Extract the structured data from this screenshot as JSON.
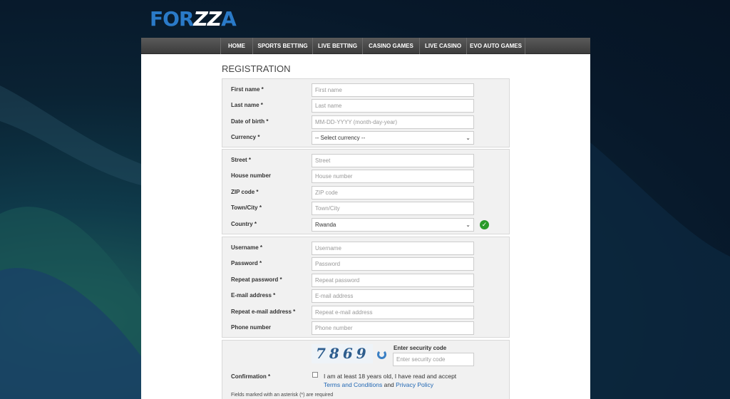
{
  "logo": {
    "part1": "FOR",
    "part2": "ZZ",
    "part3": "A"
  },
  "nav": {
    "items": [
      {
        "label": "HOME"
      },
      {
        "label": "SPORTS BETTING"
      },
      {
        "label": "LIVE BETTING"
      },
      {
        "label": "CASINO GAMES"
      },
      {
        "label": "LIVE CASINO"
      },
      {
        "label": "EVO AUTO GAMES"
      }
    ]
  },
  "form": {
    "title": "REGISTRATION",
    "first_name": {
      "label": "First name *",
      "placeholder": "First name"
    },
    "last_name": {
      "label": "Last name *",
      "placeholder": "Last name"
    },
    "dob": {
      "label": "Date of birth *",
      "placeholder": "MM-DD-YYYY (month-day-year)"
    },
    "currency": {
      "label": "Currency *",
      "value": "-- Select currency --"
    },
    "street": {
      "label": "Street *",
      "placeholder": "Street"
    },
    "house_number": {
      "label": "House number",
      "placeholder": "House number"
    },
    "zip": {
      "label": "ZIP code *",
      "placeholder": "ZIP code"
    },
    "town": {
      "label": "Town/City *",
      "placeholder": "Town/City"
    },
    "country": {
      "label": "Country *",
      "value": "Rwanda"
    },
    "username": {
      "label": "Username *",
      "placeholder": "Username"
    },
    "password": {
      "label": "Password *",
      "placeholder": "Password"
    },
    "repeat_password": {
      "label": "Repeat password *",
      "placeholder": "Repeat password"
    },
    "email": {
      "label": "E-mail address *",
      "placeholder": "E-mail address"
    },
    "repeat_email": {
      "label": "Repeat e-mail address *",
      "placeholder": "Repeat e-mail address"
    },
    "phone": {
      "label": "Phone number",
      "placeholder": "Phone number"
    },
    "confirmation": {
      "label": "Confirmation *",
      "captcha_text": "7869",
      "security_label": "Enter security code",
      "security_placeholder": "Enter security code",
      "text_before": "I am at least 18 years old, I have read and accept",
      "terms_link": "Terms and Conditions",
      "and": "and",
      "privacy_link": "Privacy Policy",
      "note": "Fields marked with an asterisk (*) are required"
    }
  },
  "colors": {
    "accent": "#2a7ac8",
    "link": "#1f66b3",
    "valid": "#2a9a2a",
    "nav_bg": "#4a4a4a"
  }
}
